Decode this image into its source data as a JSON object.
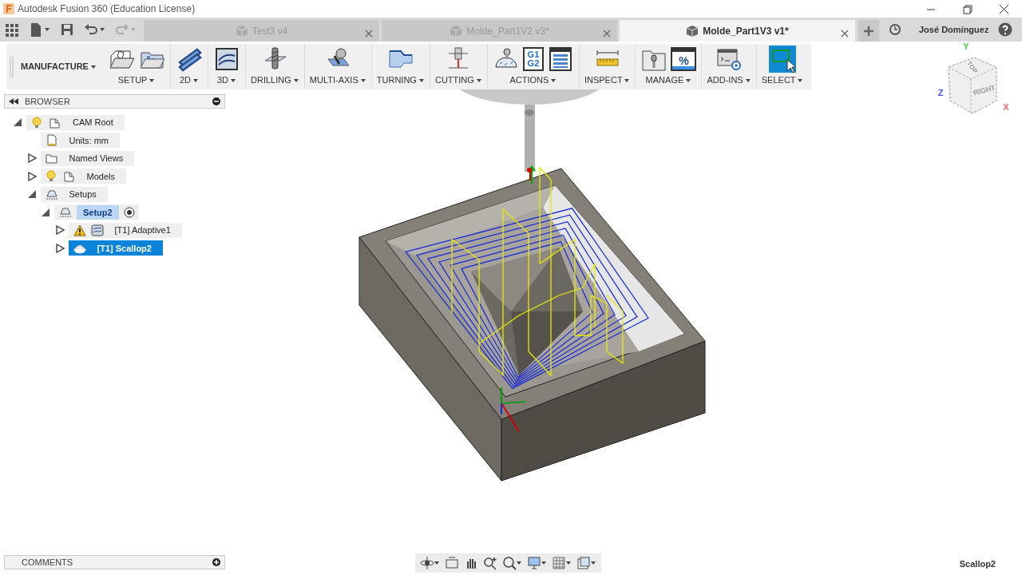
{
  "window": {
    "title": "Autodesk Fusion 360 (Education License)"
  },
  "tabs": [
    {
      "label": "Test3 v4",
      "selected": false
    },
    {
      "label": "Molde_Part1V2 v3*",
      "selected": false
    },
    {
      "label": "Molde_Part1V3 v1*",
      "selected": true
    }
  ],
  "user": {
    "name": "José Domínguez"
  },
  "toolbar": {
    "workspace": "MANUFACTURE",
    "groups": [
      {
        "label": "SETUP",
        "selected": false
      },
      {
        "label": "2D",
        "selected": false
      },
      {
        "label": "3D",
        "selected": false
      },
      {
        "label": "DRILLING",
        "selected": false
      },
      {
        "label": "MULTI-AXIS",
        "selected": false
      },
      {
        "label": "TURNING",
        "selected": false
      },
      {
        "label": "CUTTING",
        "selected": false
      },
      {
        "label": "ACTIONS",
        "selected": false,
        "glyphs": [
          "G1",
          "G2"
        ]
      },
      {
        "label": "INSPECT",
        "selected": false
      },
      {
        "label": "MANAGE",
        "selected": false,
        "glyphs": [
          "%"
        ]
      },
      {
        "label": "ADD-INS",
        "selected": false
      },
      {
        "label": "SELECT",
        "selected": true
      }
    ]
  },
  "browser": {
    "title": "BROWSER",
    "tree": [
      {
        "label": "CAM Root",
        "kind": "root",
        "expanded": true,
        "selected": false,
        "active": false,
        "warning": false,
        "children": [
          {
            "label": "Units: mm",
            "kind": "document",
            "selected": false,
            "active": false,
            "warning": false
          },
          {
            "label": "Named Views",
            "kind": "folder",
            "expanded": false,
            "selected": false,
            "active": false,
            "warning": false
          },
          {
            "label": "Models",
            "kind": "component",
            "expanded": false,
            "selected": false,
            "active": false,
            "warning": false
          },
          {
            "label": "Setups",
            "kind": "setups",
            "expanded": true,
            "selected": false,
            "active": false,
            "warning": false,
            "children": [
              {
                "label": "Setup2",
                "kind": "setup",
                "expanded": true,
                "selected": false,
                "active": true,
                "warning": false,
                "children": [
                  {
                    "label": "[T1] Adaptive1",
                    "kind": "adaptive",
                    "expanded": false,
                    "selected": false,
                    "active": false,
                    "warning": true
                  },
                  {
                    "label": "[T1] Scallop2",
                    "kind": "scallop",
                    "expanded": false,
                    "selected": true,
                    "active": false,
                    "warning": false
                  }
                ]
              }
            ]
          }
        ]
      }
    ]
  },
  "view_cube": {
    "faces": [
      "TOP",
      "RIGHT"
    ],
    "axes": [
      "X",
      "Y",
      "Z"
    ]
  },
  "comments": {
    "title": "COMMENTS"
  },
  "status_bar": {
    "text": "Scallop2"
  }
}
